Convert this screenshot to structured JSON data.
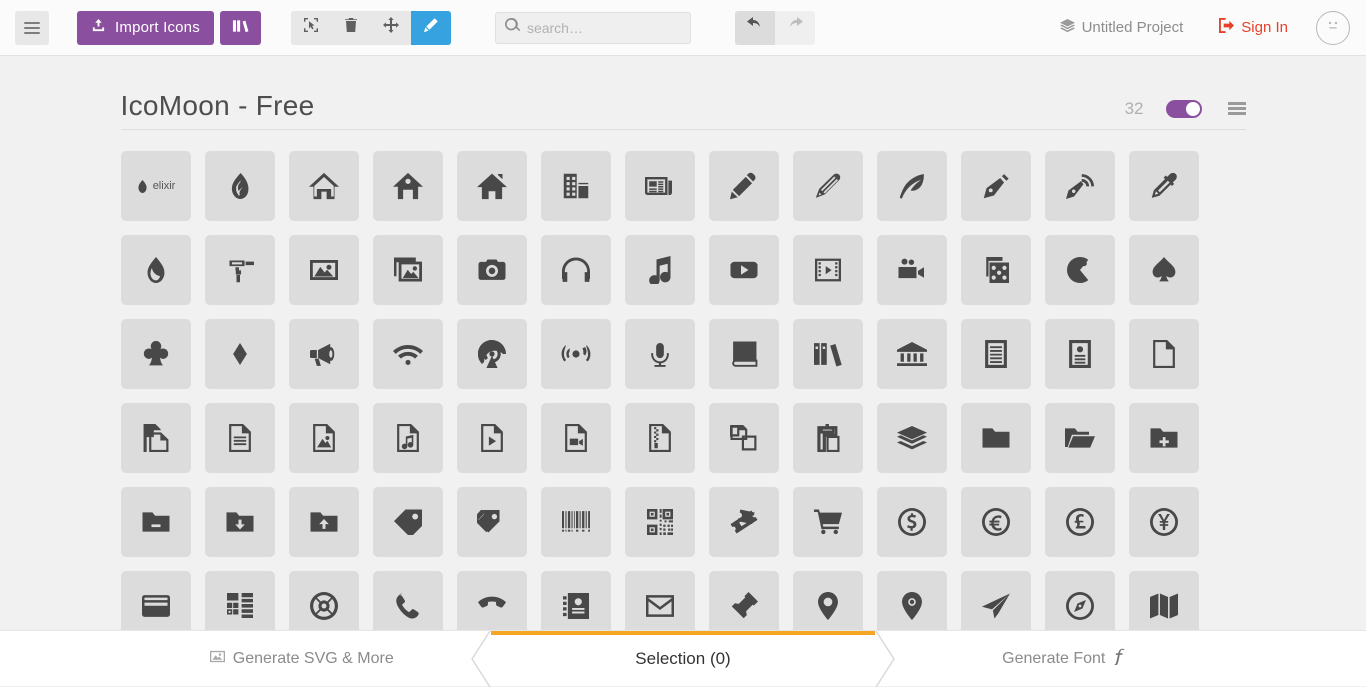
{
  "toolbar": {
    "menu_icon": "hamburger-menu-icon",
    "import_label": "Import Icons",
    "import_icon": "upload-icon",
    "library_icon": "library-icon",
    "tools": [
      {
        "name": "select-tool",
        "icon": "cursor-select-icon",
        "active": false
      },
      {
        "name": "delete-tool",
        "icon": "trash-icon",
        "active": false
      },
      {
        "name": "move-tool",
        "icon": "move-arrows-icon",
        "active": false
      },
      {
        "name": "edit-tool",
        "icon": "pencil-icon",
        "active": true
      }
    ],
    "search": {
      "value": "",
      "placeholder": "search…",
      "icon": "search-icon"
    },
    "undo_icon": "undo-arrow-icon",
    "redo_icon": "redo-arrow-icon",
    "project_name": "Untitled Project",
    "project_icon": "layers-icon",
    "signin_label": "Sign In",
    "signin_icon": "login-arrow-icon",
    "avatar_icon": "neutral-face-icon",
    "accent_purple": "#8a4f9e",
    "accent_blue": "#36a2e0",
    "accent_red": "#e8402a"
  },
  "iconset": {
    "title": "IcoMoon - Free",
    "count": "32",
    "toggle_on": true,
    "toggle_color": "#8a4f9e",
    "menu_icon": "list-menu-icon",
    "icons": [
      "elixir-logo",
      "elixir-droplet",
      "home-outline",
      "home-solid",
      "home-filled",
      "office-building",
      "newspaper",
      "pencil",
      "pen-stroke",
      "quill",
      "pen-nib",
      "pen-nib-wireless",
      "eyedropper",
      "droplet",
      "paint-roller",
      "image",
      "images",
      "camera",
      "headphones",
      "music-note",
      "play-video",
      "film-strip",
      "video-camera",
      "dice",
      "pacman",
      "spade",
      "clubs",
      "diamond",
      "bullhorn",
      "wifi",
      "broadcast-tower",
      "podcast-signal",
      "microphone",
      "book",
      "books",
      "library",
      "reader",
      "profile-card",
      "file-empty",
      "files-empty",
      "file-text",
      "file-picture",
      "file-music",
      "file-play",
      "file-video",
      "file-zip",
      "copy-files",
      "paste-clipboard",
      "stack-layers",
      "folder",
      "folder-open",
      "folder-plus",
      "folder-minus",
      "folder-download",
      "folder-upload",
      "price-tag",
      "price-tags",
      "barcode",
      "qrcode",
      "ticket",
      "shopping-cart",
      "coin-dollar",
      "coin-euro",
      "coin-pound",
      "coin-yen",
      "credit-card",
      "calculator",
      "lifebuoy",
      "phone",
      "phone-hang-up",
      "address-book",
      "envelope",
      "pushpin",
      "location-pin",
      "map-marker",
      "paper-plane",
      "compass",
      "map"
    ]
  },
  "footer": {
    "generate_svg_label": "Generate SVG & More",
    "generate_svg_icon": "image-icon",
    "selection_label": "Selection (0)",
    "generate_font_label": "Generate Font",
    "generate_font_icon": "font-f-icon",
    "active_tab_color": "#f5a623"
  }
}
